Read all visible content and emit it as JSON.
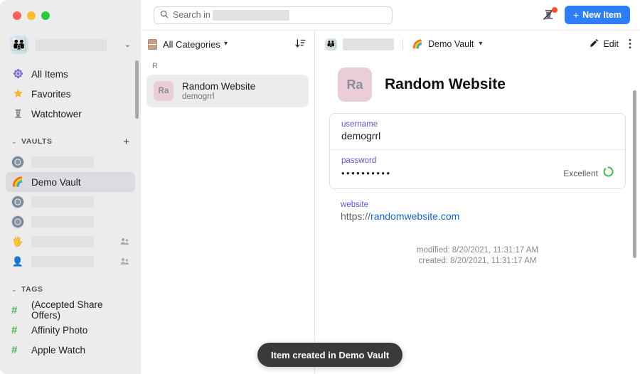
{
  "window": {
    "traffic_lights": [
      "close",
      "minimize",
      "zoom"
    ],
    "accent_color": "#2d7ff9"
  },
  "sidebar": {
    "account": {
      "name_redacted": true,
      "avatar_icon": "family-avatar",
      "chevron": "⌄"
    },
    "nav": [
      {
        "label": "All Items",
        "icon": "all-items-icon"
      },
      {
        "label": "Favorites",
        "icon": "star-icon"
      },
      {
        "label": "Watchtower",
        "icon": "watchtower-icon"
      }
    ],
    "vaults_section": {
      "label": "VAULTS",
      "add_label": "+",
      "caret": "⌄"
    },
    "vaults": [
      {
        "label": "",
        "redacted": true,
        "icon": "gear-vault-icon",
        "selected": false,
        "shared": false
      },
      {
        "label": "Demo Vault",
        "redacted": false,
        "icon": "rainbow-vault-icon",
        "selected": true,
        "shared": false
      },
      {
        "label": "",
        "redacted": true,
        "icon": "gear-vault-icon",
        "selected": false,
        "shared": false
      },
      {
        "label": "",
        "redacted": true,
        "icon": "gear-vault-icon",
        "selected": false,
        "shared": false
      },
      {
        "label": "",
        "redacted": true,
        "icon": "hand-vault-icon",
        "selected": false,
        "shared": true
      },
      {
        "label": "",
        "redacted": true,
        "icon": "person-vault-icon",
        "selected": false,
        "shared": true
      }
    ],
    "tags_section": {
      "label": "TAGS",
      "caret": "⌄"
    },
    "tags": [
      {
        "label": "(Accepted Share Offers)"
      },
      {
        "label": "Affinity Photo"
      },
      {
        "label": "Apple Watch"
      }
    ]
  },
  "topbar": {
    "search": {
      "placeholder": "Search in",
      "value": "",
      "scope_redacted": true
    },
    "alert_icon": "watchtower-alert-icon",
    "alert_badge": true,
    "new_item_label": "New Item",
    "new_item_plus": "+"
  },
  "item_list": {
    "category_filter": "All Categories",
    "category_icon": "file-cabinet-icon",
    "sort_icon": "sort-descending-icon",
    "groups": [
      {
        "letter": "R",
        "items": [
          {
            "initials": "Ra",
            "title": "Random Website",
            "subtitle": "demogrrl",
            "selected": true
          }
        ]
      }
    ]
  },
  "detail": {
    "header": {
      "account_redacted": true,
      "account_icon": "family-avatar",
      "vault_icon": "rainbow-vault-icon",
      "vault_name": "Demo Vault",
      "vault_chevron": "⌄",
      "edit_label": "Edit",
      "edit_icon": "pencil-icon",
      "more_icon": "more-vertical-icon"
    },
    "item": {
      "initials": "Ra",
      "title": "Random Website"
    },
    "fields": [
      {
        "label": "username",
        "value": "demogrrl",
        "type": "text"
      },
      {
        "label": "password",
        "value": "••••••••••",
        "type": "password",
        "strength": "Excellent",
        "strength_color": "#2dbd3a"
      }
    ],
    "website": {
      "label": "website",
      "scheme": "https://",
      "host": "randomwebsite.com"
    },
    "timestamps": {
      "modified": "modified: 8/20/2021, 11:31:17 AM",
      "created": "created: 8/20/2021, 11:31:17 AM"
    }
  },
  "toast": {
    "message": "Item created in Demo Vault"
  }
}
